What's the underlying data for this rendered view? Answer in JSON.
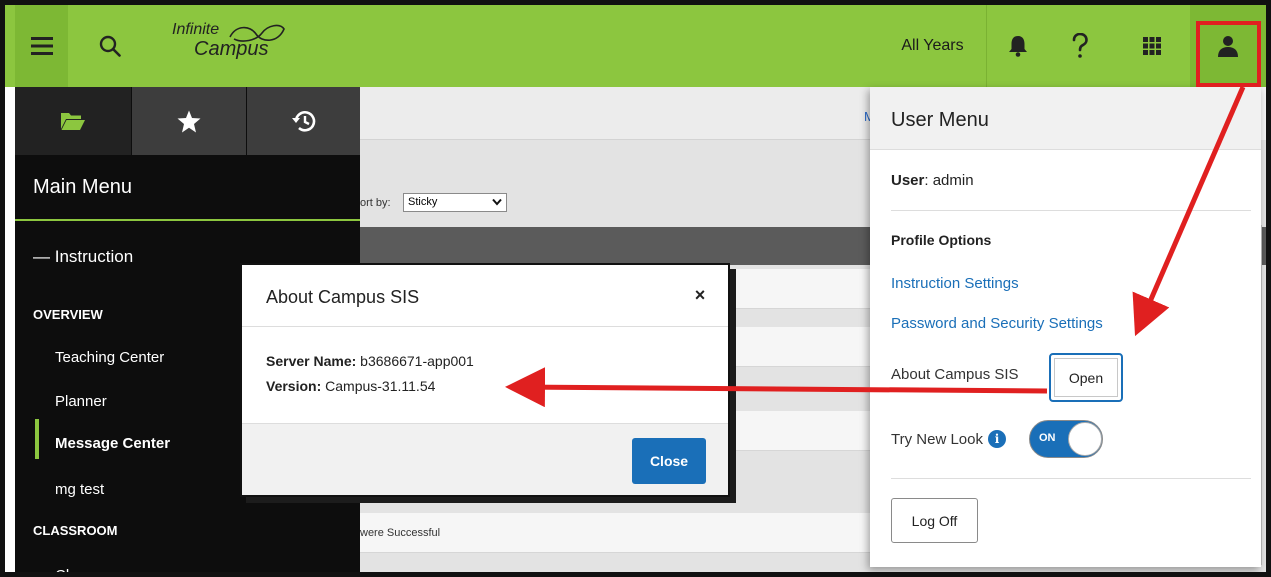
{
  "topbar": {
    "logo_line1": "Infinite",
    "logo_line2": "Campus",
    "year_selector": "All Years",
    "colors": {
      "bar": "#8cc63f",
      "accent": "#1a6fb8",
      "annotation": "#e02020"
    },
    "icons": [
      "hamburger-menu-icon",
      "search-icon",
      "bell-icon",
      "help-icon",
      "apps-grid-icon",
      "user-icon"
    ]
  },
  "sidebar": {
    "tabs": [
      {
        "icon": "folder-open-icon"
      },
      {
        "icon": "star-icon"
      },
      {
        "icon": "history-icon"
      }
    ],
    "title": "Main Menu",
    "section": "Instruction",
    "groups": [
      {
        "heading": "OVERVIEW",
        "items": [
          "Teaching Center",
          "Planner",
          "Message Center",
          "mg test"
        ]
      },
      {
        "heading": "CLASSROOM",
        "items": [
          "Classroom"
        ]
      }
    ],
    "active_item": "Message Center"
  },
  "content": {
    "crumb": "M",
    "sort_label": "ort by:",
    "sort_value": "Sticky",
    "row_text": "were Successful"
  },
  "modal": {
    "title": "About Campus SIS",
    "close_x": "×",
    "server_label": "Server Name:",
    "server_value": "b3686671-app001",
    "version_label": "Version:",
    "version_value": "Campus-31.11.54",
    "close_button": "Close"
  },
  "user_menu": {
    "title": "User Menu",
    "user_label": "User",
    "user_value": ": admin",
    "profile_heading": "Profile Options",
    "link_instruction": "Instruction Settings",
    "link_password": "Password and Security Settings",
    "about_label": "About Campus SIS",
    "open_button": "Open",
    "try_new_look": "Try New Look",
    "toggle_text": "ON",
    "logoff_button": "Log Off"
  }
}
